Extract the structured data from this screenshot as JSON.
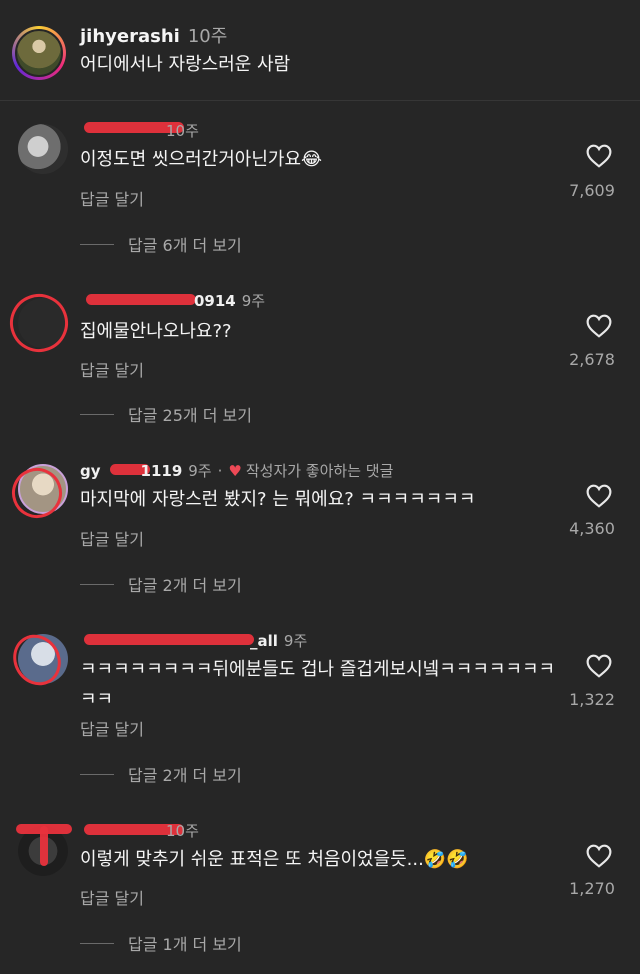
{
  "caption": {
    "username": "jihyerashi",
    "time": "10주",
    "text": "어디에서나 자랑스러운 사람"
  },
  "comments": [
    {
      "time": "10주",
      "text": "이정도면 씻으러간거아닌가요😂",
      "reply_label": "답글 달기",
      "likes": "7,609",
      "more_replies": "답글 6개 더 보기"
    },
    {
      "handle_visible": "0914",
      "time": "9주",
      "text": "집에물안나오나요??",
      "reply_label": "답글 달기",
      "likes": "2,678",
      "more_replies": "답글 25개 더 보기"
    },
    {
      "handle_visible": "gy",
      "handle_visible_end": "1119",
      "time": "9주",
      "dot": "·",
      "liked_by_author": "작성자가 좋아하는 댓글",
      "text": "마지막에 자랑스런 봤지? 는 뭐에요? ㅋㅋㅋㅋㅋㅋㅋ",
      "reply_label": "답글 달기",
      "likes": "4,360",
      "more_replies": "답글 2개 더 보기"
    },
    {
      "handle_visible": "_all",
      "time": "9주",
      "text": "ㅋㅋㅋㅋㅋㅋㅋㅋ뒤에분들도 겁나 즐겁게보시넼ㅋㅋㅋㅋㅋㅋㅋㅋㅋ",
      "reply_label": "답글 달기",
      "likes": "1,322",
      "more_replies": "답글 2개 더 보기"
    },
    {
      "time": "10주",
      "text": "이렇게 맞추기 쉬운 표적은 또 처음이었을듯...🤣🤣",
      "reply_label": "답글 달기",
      "likes": "1,270",
      "more_replies": "답글 1개 더 보기"
    }
  ],
  "colors": {
    "background": "#262626",
    "redaction": "#e8323c",
    "heart_liked": "#ed4956"
  },
  "icons": {
    "like": "heart-outline-icon",
    "author_liked": "heart-filled-icon"
  }
}
